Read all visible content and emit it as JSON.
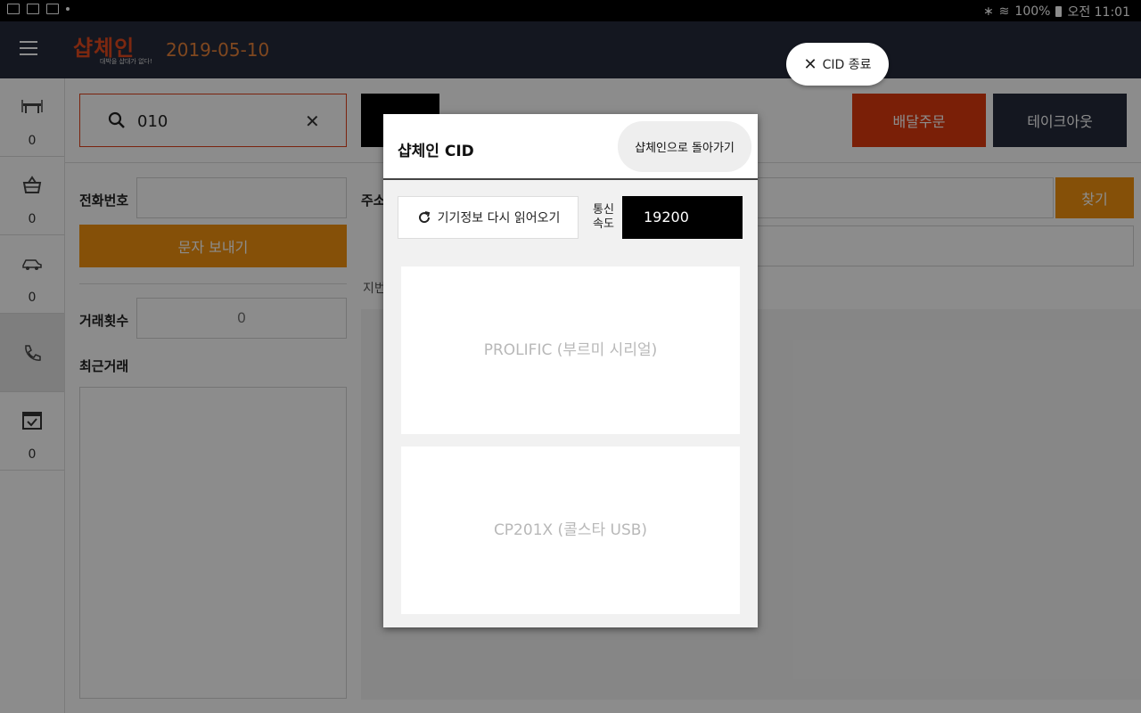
{
  "status_bar": {
    "battery": "100%",
    "time": "오전 11:01"
  },
  "app_bar": {
    "logo_text": "샵체인",
    "logo_tagline": "대박을 샵대가 없다!",
    "date": "2019-05-10"
  },
  "sidebar": {
    "items": [
      {
        "icon": "dining-table-icon",
        "count": "0"
      },
      {
        "icon": "basket-icon",
        "count": "0"
      },
      {
        "icon": "delivery-car-icon",
        "count": "0"
      },
      {
        "icon": "phone-icon",
        "count": ""
      },
      {
        "icon": "calendar-check-icon",
        "count": "0"
      }
    ]
  },
  "search": {
    "value": "010"
  },
  "actions": {
    "delivery_label": "배달주문",
    "takeout_label": "테이크아웃"
  },
  "form": {
    "phone_label": "전화번호",
    "address_label": "주소",
    "sms_button": "문자 보내기",
    "find_button": "찾기",
    "jibun_label": "지번",
    "trade_count_label": "거래횟수",
    "trade_count_value": "0",
    "recent_trade_label": "최근거래"
  },
  "cid_close": {
    "label": "CID 종료"
  },
  "dialog": {
    "title": "샵체인 CID",
    "back_button": "샵체인으로 돌아가기",
    "reload_button": "기기정보 다시 읽어오기",
    "speed_label_1": "통신",
    "speed_label_2": "속도",
    "speed_value": "19200",
    "devices": [
      "PROLIFIC (부르미 시리얼)",
      "CP201X (콜스타 USB)"
    ]
  },
  "colors": {
    "app_bar": "#252a3b",
    "accent_red": "#df3a0e",
    "accent_orange": "#f2920f"
  }
}
